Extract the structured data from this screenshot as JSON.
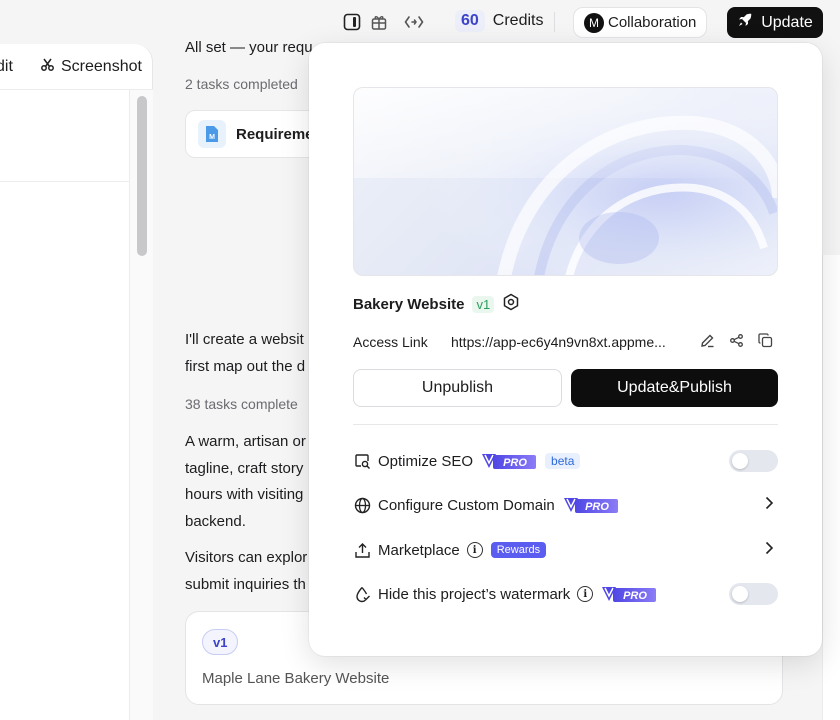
{
  "topbar": {
    "credits_value": "60",
    "credits_label": "Credits",
    "collab_avatar": "M",
    "collab_label": "Collaboration",
    "update_label": "Update"
  },
  "left_pane": {
    "edit_label": "dit",
    "screenshot_label": "Screenshot"
  },
  "chat": {
    "line1": "All set — your requ",
    "tasks1": "2 tasks completed",
    "req_card_title": "Requireme",
    "para1_line1": "I'll create a websit",
    "para1_line2": "first map out the d",
    "tasks2": "38 tasks complete",
    "para2_lines": [
      "A warm, artisan or",
      "tagline, craft story",
      "hours with visiting",
      "backend."
    ],
    "para3_lines": [
      "Visitors can explor",
      "submit inquiries th"
    ],
    "version_badge": "v1",
    "version_title": "Maple Lane Bakery Website"
  },
  "popup": {
    "project_name": "Bakery Website",
    "project_version": "v1",
    "access_link_label": "Access Link",
    "access_link_url": "https://app-ec6y4n9vn8xt.appme...",
    "unpublish_label": "Unpublish",
    "update_publish_label": "Update&Publish",
    "options": [
      {
        "label": "Optimize SEO",
        "pro": "PRO",
        "tag": "beta",
        "control": "toggle",
        "enabled": false
      },
      {
        "label": "Configure Custom Domain",
        "pro": "PRO",
        "control": "chevron"
      },
      {
        "label": "Marketplace",
        "tag": "Rewards",
        "control": "chevron"
      },
      {
        "label": "Hide this project’s watermark",
        "pro": "PRO",
        "control": "toggle",
        "enabled": false
      }
    ]
  },
  "colors": {
    "accent": "#3b43c8",
    "pro_gradient_start": "#4f46e5",
    "pro_gradient_end": "#8b7cf6",
    "primary_button": "#0d0d0d"
  }
}
